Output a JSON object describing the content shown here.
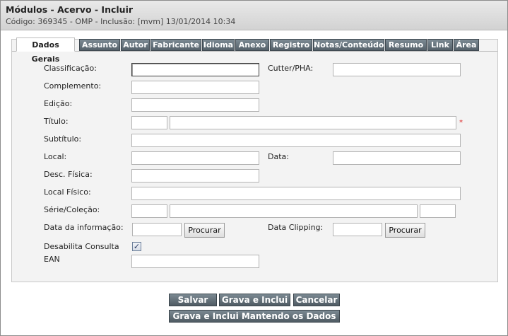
{
  "header": {
    "title": "Módulos - Acervo - Incluir",
    "subtitle": "Código: 369345 - OMP - Inclusão: [mvm] 13/01/2014 10:34"
  },
  "tabs": [
    {
      "label": "Dados Gerais",
      "active": true
    },
    {
      "label": "Assunto"
    },
    {
      "label": "Autor"
    },
    {
      "label": "Fabricante"
    },
    {
      "label": "Idioma"
    },
    {
      "label": "Anexo"
    },
    {
      "label": "Registro"
    },
    {
      "label": "Notas/Conteúdo"
    },
    {
      "label": "Resumo"
    },
    {
      "label": "Link"
    },
    {
      "label": "Área"
    }
  ],
  "form": {
    "classificacao_label": "Classificação:",
    "cutter_label": "Cutter/PHA:",
    "complemento_label": "Complemento:",
    "edicao_label": "Edição:",
    "titulo_label": "Título:",
    "required_mark": "*",
    "subtitulo_label": "Subtítulo:",
    "local_label": "Local:",
    "data_label": "Data:",
    "desc_fisica_label": "Desc. Física:",
    "local_fisico_label": "Local Físico:",
    "serie_colecao_label": "Série/Coleção:",
    "data_informacao_label": "Data da informação:",
    "procurar_label": "Procurar",
    "data_clipping_label": "Data Clipping:",
    "desabilita_consulta_label": "Desabilita Consulta",
    "desabilita_consulta_checked": "✓",
    "ean_label": "EAN",
    "values": {
      "classificacao": "",
      "cutter": "",
      "complemento": "",
      "edicao": "",
      "titulo_prefix": "",
      "titulo": "",
      "subtitulo": "",
      "local": "",
      "data": "",
      "desc_fisica": "",
      "local_fisico": "",
      "serie_a": "",
      "serie_b": "",
      "serie_c": "",
      "data_informacao": "",
      "data_clipping": "",
      "ean": ""
    }
  },
  "actions": {
    "salvar": "Salvar",
    "grava_inclui": "Grava e Inclui",
    "cancelar": "Cancelar",
    "grava_inclui_mantendo": "Grava e Inclui Mantendo os Dados"
  },
  "colors": {
    "tab_bg": "#55616a",
    "button_bg": "#4f5b63",
    "required": "#dd2222"
  }
}
